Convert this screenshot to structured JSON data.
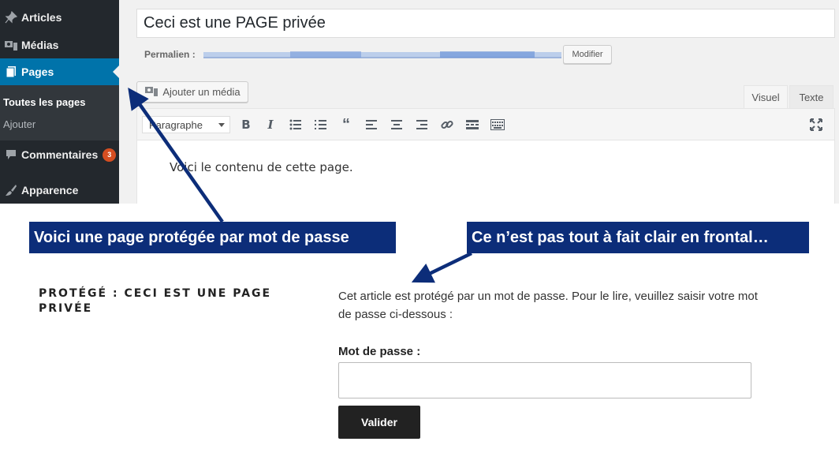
{
  "sidebar": {
    "items": [
      {
        "label": "Articles",
        "icon": "pin-icon"
      },
      {
        "label": "Médias",
        "icon": "media-icon"
      },
      {
        "label": "Pages",
        "icon": "pages-icon"
      },
      {
        "label": "Commentaires",
        "icon": "comment-icon",
        "badge": "3"
      },
      {
        "label": "Apparence",
        "icon": "brush-icon"
      }
    ],
    "submenu": [
      "Toutes les pages",
      "Ajouter"
    ]
  },
  "editor": {
    "title": "Ceci est une PAGE privée",
    "permalink_label": "Permalien :",
    "modify_label": "Modifier",
    "add_media_label": "Ajouter un média",
    "tab_visual": "Visuel",
    "tab_text": "Texte",
    "format": "Paragraphe",
    "content": "Voici le contenu de cette page."
  },
  "callouts": {
    "left": "Voici une page protégée par mot de passe",
    "right": "Ce n’est pas tout à fait clair en frontal…"
  },
  "frontend": {
    "title": "PROTÉGÉ : CECI EST UNE PAGE PRIVÉE",
    "message": "Cet article est protégé par un mot de passe. Pour le lire, veuillez saisir votre mot de passe ci-dessous :",
    "password_label": "Mot de passe :",
    "submit_label": "Valider"
  },
  "colors": {
    "admin_sidebar": "#23282d",
    "admin_current": "#0073aa",
    "callout_bg": "#0c2d79",
    "badge": "#d54e21"
  }
}
